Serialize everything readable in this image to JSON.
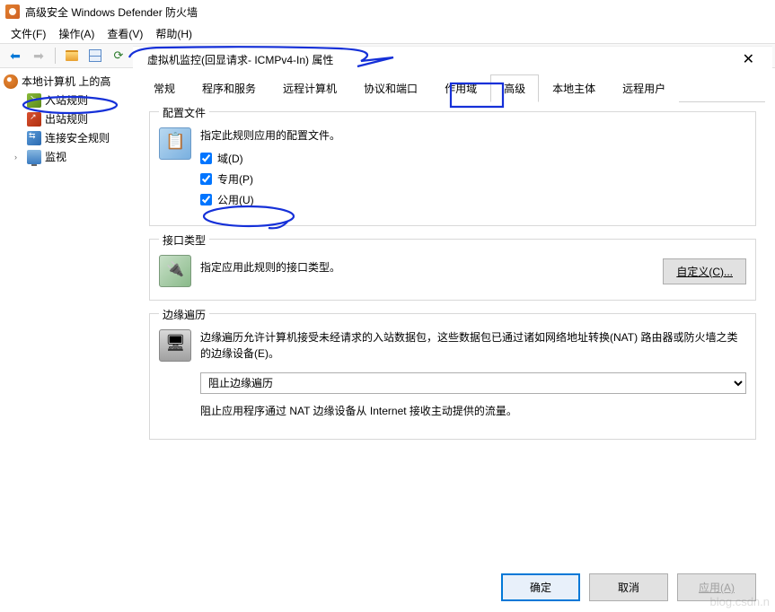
{
  "window": {
    "title": "高级安全 Windows Defender 防火墙"
  },
  "menu": {
    "file": "文件(F)",
    "action": "操作(A)",
    "view": "查看(V)",
    "help": "帮助(H)"
  },
  "tree": {
    "root": "本地计算机 上的高",
    "inbound": "入站规则",
    "outbound": "出站规则",
    "connection": "连接安全规则",
    "monitor": "监视"
  },
  "dialog": {
    "title": "虚拟机监控(回显请求- ICMPv4-In) 属性"
  },
  "tabs": {
    "general": "常规",
    "programs": "程序和服务",
    "remote_computers": "远程计算机",
    "protocols": "协议和端口",
    "scope": "作用域",
    "advanced": "高级",
    "local_principals": "本地主体",
    "remote_users": "远程用户"
  },
  "profiles": {
    "group_title": "配置文件",
    "desc": "指定此规则应用的配置文件。",
    "domain": "域(D)",
    "private": "专用(P)",
    "public": "公用(U)"
  },
  "interface": {
    "group_title": "接口类型",
    "desc": "指定应用此规则的接口类型。",
    "customize_btn": "自定义(C)..."
  },
  "traversal": {
    "group_title": "边缘遍历",
    "desc": "边缘遍历允许计算机接受未经请求的入站数据包，这些数据包已通过诸如网络地址转换(NAT) 路由器或防火墙之类的边缘设备(E)。",
    "selected": "阻止边缘遍历",
    "help": "阻止应用程序通过 NAT 边缘设备从 Internet 接收主动提供的流量。"
  },
  "buttons": {
    "ok": "确定",
    "cancel": "取消",
    "apply": "应用(A)"
  },
  "watermark": "blog.csdn.n"
}
